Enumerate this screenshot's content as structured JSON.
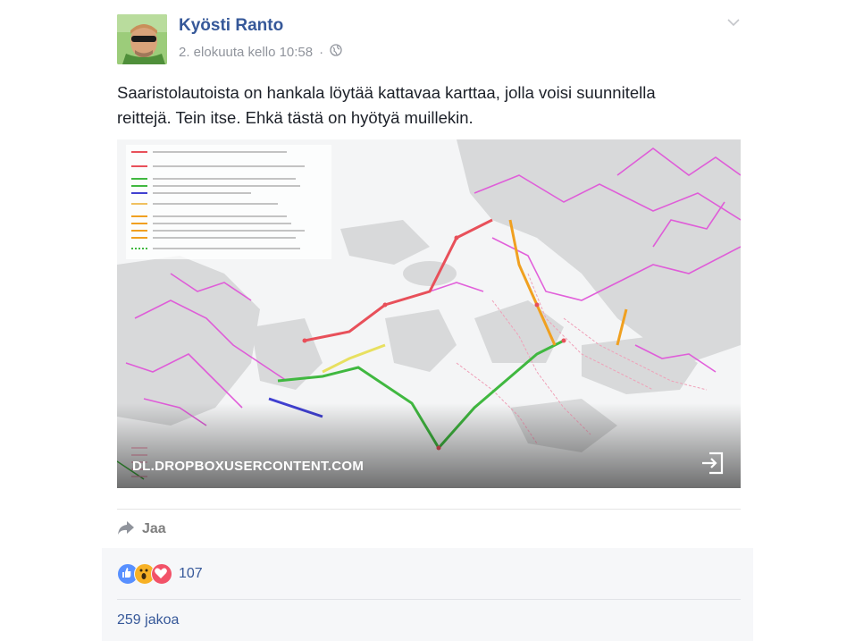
{
  "post": {
    "author": "Kyösti Ranto",
    "timestamp": "2. elokuuta kello 10:58",
    "separator": "·",
    "privacy_icon": "globe-icon",
    "options_icon": "chevron-down-icon",
    "text_line1": "Saaristolautoista on hankala löytää kattavaa karttaa, jolla voisi suunnitella",
    "text_line2": "reittejä. Tein itse. Ehkä tästä on hyötyä muillekin."
  },
  "link_card": {
    "domain": "DL.DROPBOXUSERCONTENT.COM",
    "exit_icon": "external-link-icon"
  },
  "actions": {
    "share_label": "Jaa",
    "share_icon": "share-arrow-icon"
  },
  "footer": {
    "reactions": [
      "like-icon",
      "wow-icon",
      "love-icon"
    ],
    "reaction_count": "107",
    "shares_label": "259 jakoa"
  },
  "colors": {
    "link_blue": "#365899",
    "like": "#5890ff",
    "wow": "#f7b125",
    "love": "#f25268",
    "route_pink": "#e050d8",
    "route_red": "#e8505a",
    "route_green": "#40b840",
    "route_yellow": "#e8e060",
    "route_orange": "#f0a020"
  }
}
